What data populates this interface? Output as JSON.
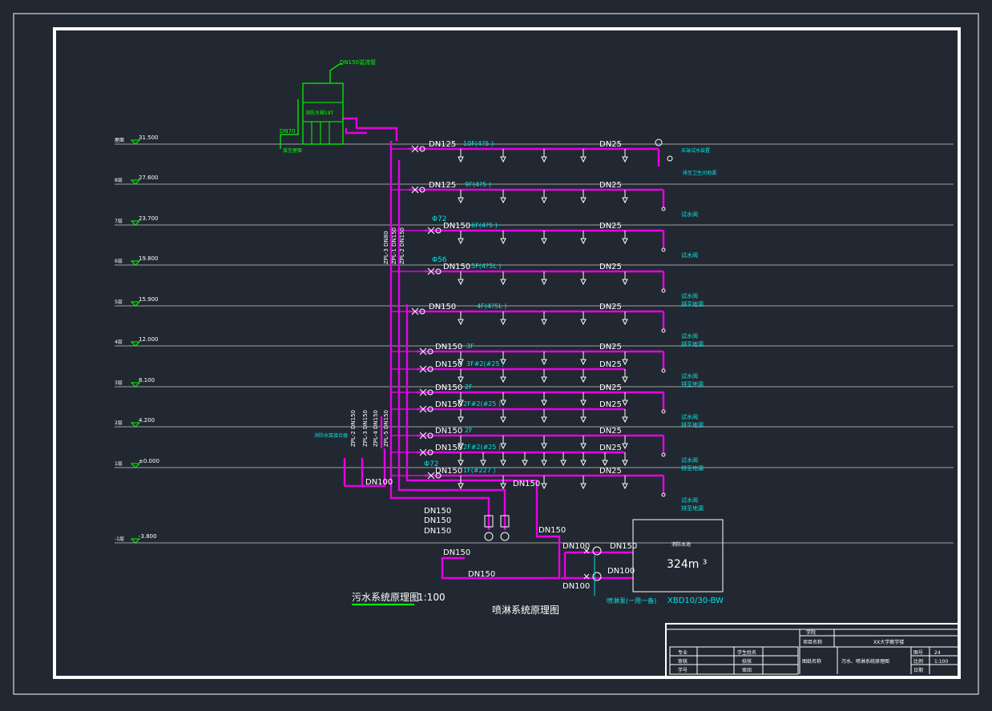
{
  "colors": {
    "background": "#222831",
    "frame": "#ffffff",
    "pipe": "#e600e6",
    "equipment": "#00ff00",
    "annotation": "#00e5e5",
    "level_line": "#c8c8c8",
    "text": "#ffffff"
  },
  "levels": [
    {
      "floor": "屋面",
      "elev": "31.500"
    },
    {
      "floor": "8层",
      "elev": "27.600"
    },
    {
      "floor": "7层",
      "elev": "23.700"
    },
    {
      "floor": "6层",
      "elev": "19.800"
    },
    {
      "floor": "5层",
      "elev": "15.900"
    },
    {
      "floor": "4层",
      "elev": "12.000"
    },
    {
      "floor": "3层",
      "elev": "8.100"
    },
    {
      "floor": "2层",
      "elev": "4.200"
    },
    {
      "floor": "1层",
      "elev": "±0.000"
    },
    {
      "floor": "-1层",
      "elev": "-3.800"
    }
  ],
  "branches": [
    {
      "main": "DN125",
      "zone": "10F(4?5 )",
      "end": "DN25"
    },
    {
      "main": "DN125",
      "zone": "9F(4?5 )",
      "end": "DN25"
    },
    {
      "main": "DN150",
      "zone": "6F(4?5 )",
      "end": "DN25",
      "orifice": "Φ72"
    },
    {
      "main": "DN150",
      "zone": "5F(4?5L )",
      "end": "DN25",
      "orifice": "Φ56"
    },
    {
      "main": "DN150",
      "zone": "4F(4?5L )",
      "end": "DN25"
    },
    {
      "main": "DN150",
      "zone": "3F",
      "end": "DN25"
    },
    {
      "main": "DN150",
      "zone": "3F#2(#25 )",
      "end": "DN25"
    },
    {
      "main": "DN150",
      "zone": "2F",
      "end": "DN25"
    },
    {
      "main": "DN150",
      "zone": "2F#2(#25 )",
      "end": "DN25"
    },
    {
      "main": "DN150",
      "zone": "2F",
      "end": "DN25"
    },
    {
      "main": "DN150",
      "zone": "2F#2(#25 )",
      "end": "DN25"
    },
    {
      "main": "DN150",
      "zone": "1F(#227 )",
      "end": "DN25",
      "orifice": "Φ72"
    }
  ],
  "end_labels": {
    "test_valve": "试水阀",
    "test_valve_drain": "排至地漏",
    "roof_vent": "末端试水装置",
    "roof_drain": "排至卫生间地漏"
  },
  "risers": {
    "main_tags": [
      "ZPL-3 DN80",
      "ZPL-1 DN150",
      "ZPL-2 DN150"
    ],
    "bottom_tags": [
      "ZPL-2 DN150",
      "ZPL-3 DN150",
      "ZPL-4 DN150",
      "ZPL-5 DN150"
    ],
    "connector_label": "消防水泵接合器",
    "connector_size": "DN100"
  },
  "tank": {
    "top_label": "DN150溢流管",
    "inlet_label": "DN70",
    "body_label": "消防水箱18T",
    "drain_label": "接至屋面"
  },
  "pump_room": {
    "sizes": {
      "a": "DN150",
      "b": "DN150",
      "c": "DN150",
      "d": "DN150",
      "e": "DN150",
      "f": "DN150",
      "g": "DN150"
    },
    "dn100_a": "DN100",
    "dn100_b": "DN100",
    "dn100_c": "DN100",
    "dn150_out": "DN150",
    "pump_label": "喷淋泵(一用一备)",
    "pool_label": "消防水池",
    "pool_volume": "324m ³",
    "pump_model": "XBD10/30-BW"
  },
  "captions": {
    "sewage": "污水系统原理图",
    "sewage_scale": "1:100",
    "sprinkler": "喷淋系统原理图"
  },
  "title_block": {
    "school_label": "学院",
    "project_label": "项目名称",
    "project_name": "XX大学教学楼",
    "major": "专业",
    "review": "审核",
    "student": "学号",
    "student_name": "学生姓名",
    "checker": "校核",
    "drawer": "审阅",
    "drawing_name_label": "图纸名称",
    "drawing_name": "污水、喷淋系统原理图",
    "sheet_label": "图号",
    "sheet_no": "24",
    "scale_label": "比例",
    "scale": "1:100",
    "date_label": "日期"
  }
}
